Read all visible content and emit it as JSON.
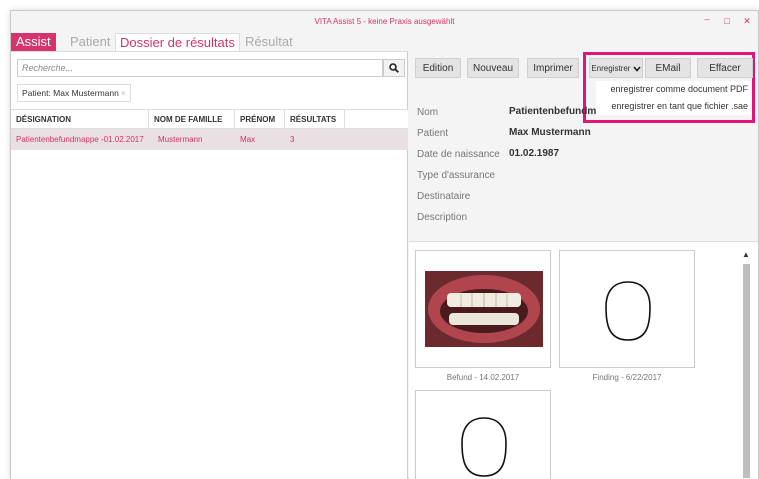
{
  "window": {
    "title": "VITA Assist 5 - keine Praxis ausgewählt",
    "controls": {
      "minimize": "–",
      "maximize": "□",
      "close": "✕"
    }
  },
  "tabs": [
    "Assist",
    "Patient",
    "Dossier de résultats",
    "Résultat"
  ],
  "left": {
    "search_placeholder": "Recherche...",
    "search_icon": "search-icon",
    "filter_chip": "Patient: Max Mustermann",
    "filter_chip_remove": "×",
    "columns": [
      "DÉSIGNATION",
      "NOM DE FAMILLE",
      "PRÉNOM",
      "RÉSULTATS"
    ],
    "rows": [
      {
        "designation": "Patientenbefundmappe -01.02.2017",
        "nom": "Mustermann",
        "prenom": "Max",
        "resultats": "3"
      }
    ]
  },
  "toolbar": {
    "edition": "Edition",
    "nouveau": "Nouveau",
    "imprimer": "Imprimer",
    "enregistrer": "Enregistrer",
    "email": "EMail",
    "effacer": "Effacer"
  },
  "save_menu": [
    "enregistrer comme document PDF",
    "enregistrer en tant que fichier .sae"
  ],
  "details": [
    {
      "label": "Nom",
      "value": "Patientenbefundm"
    },
    {
      "label": "Patient",
      "value": "Max Mustermann"
    },
    {
      "label": "Date de naissance",
      "value": "01.02.1987"
    },
    {
      "label": "Type d'assurance",
      "value": ""
    },
    {
      "label": "Destinataire",
      "value": ""
    },
    {
      "label": "Description",
      "value": ""
    }
  ],
  "gallery": [
    {
      "caption": "Befund - 14.02.2017",
      "kind": "photo"
    },
    {
      "caption": "Finding - 6/22/2017",
      "kind": "tooth-outline"
    },
    {
      "caption": "",
      "kind": "tooth-outline"
    }
  ],
  "colors": {
    "accent": "#d6336c",
    "highlight_border": "#e0147a",
    "selected_row": "#e8e0e2"
  }
}
